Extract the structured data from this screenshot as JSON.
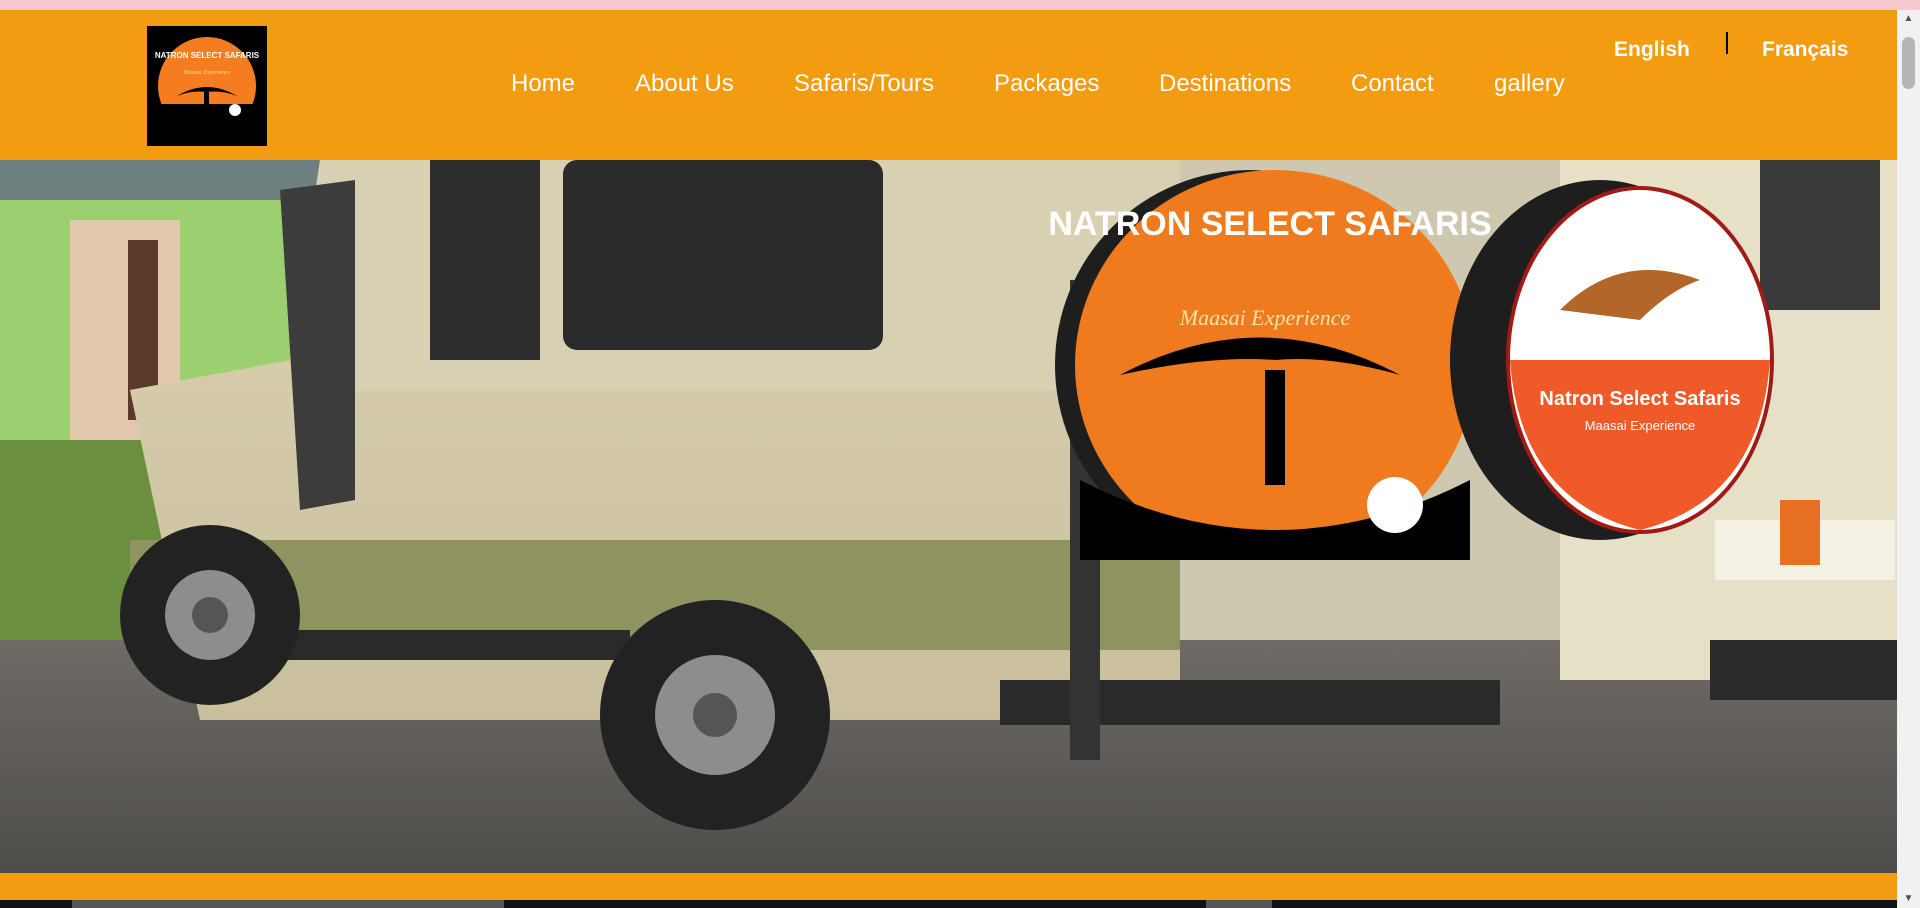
{
  "brand": {
    "logo_title": "NATRON SELECT SAFARIS",
    "logo_subtitle": "Maasai Experience"
  },
  "nav": {
    "items": [
      {
        "label": "Home"
      },
      {
        "label": "About Us"
      },
      {
        "label": "Safaris/Tours"
      },
      {
        "label": "Packages"
      },
      {
        "label": "Destinations"
      },
      {
        "label": "Contact"
      },
      {
        "label": "gallery"
      }
    ]
  },
  "languages": {
    "english": "English",
    "french": "Français"
  },
  "hero": {
    "tire_cover_left_title": "NATRON SELECT SAFARIS",
    "tire_cover_left_subtitle": "Maasai Experience",
    "tire_cover_right_title": "Natron Select Safaris",
    "tire_cover_right_subtitle": "Maasai Experience"
  },
  "colors": {
    "header_bg": "#f39c12",
    "nav_text": "#ffffff",
    "top_stripe": "#f6c9d0"
  }
}
